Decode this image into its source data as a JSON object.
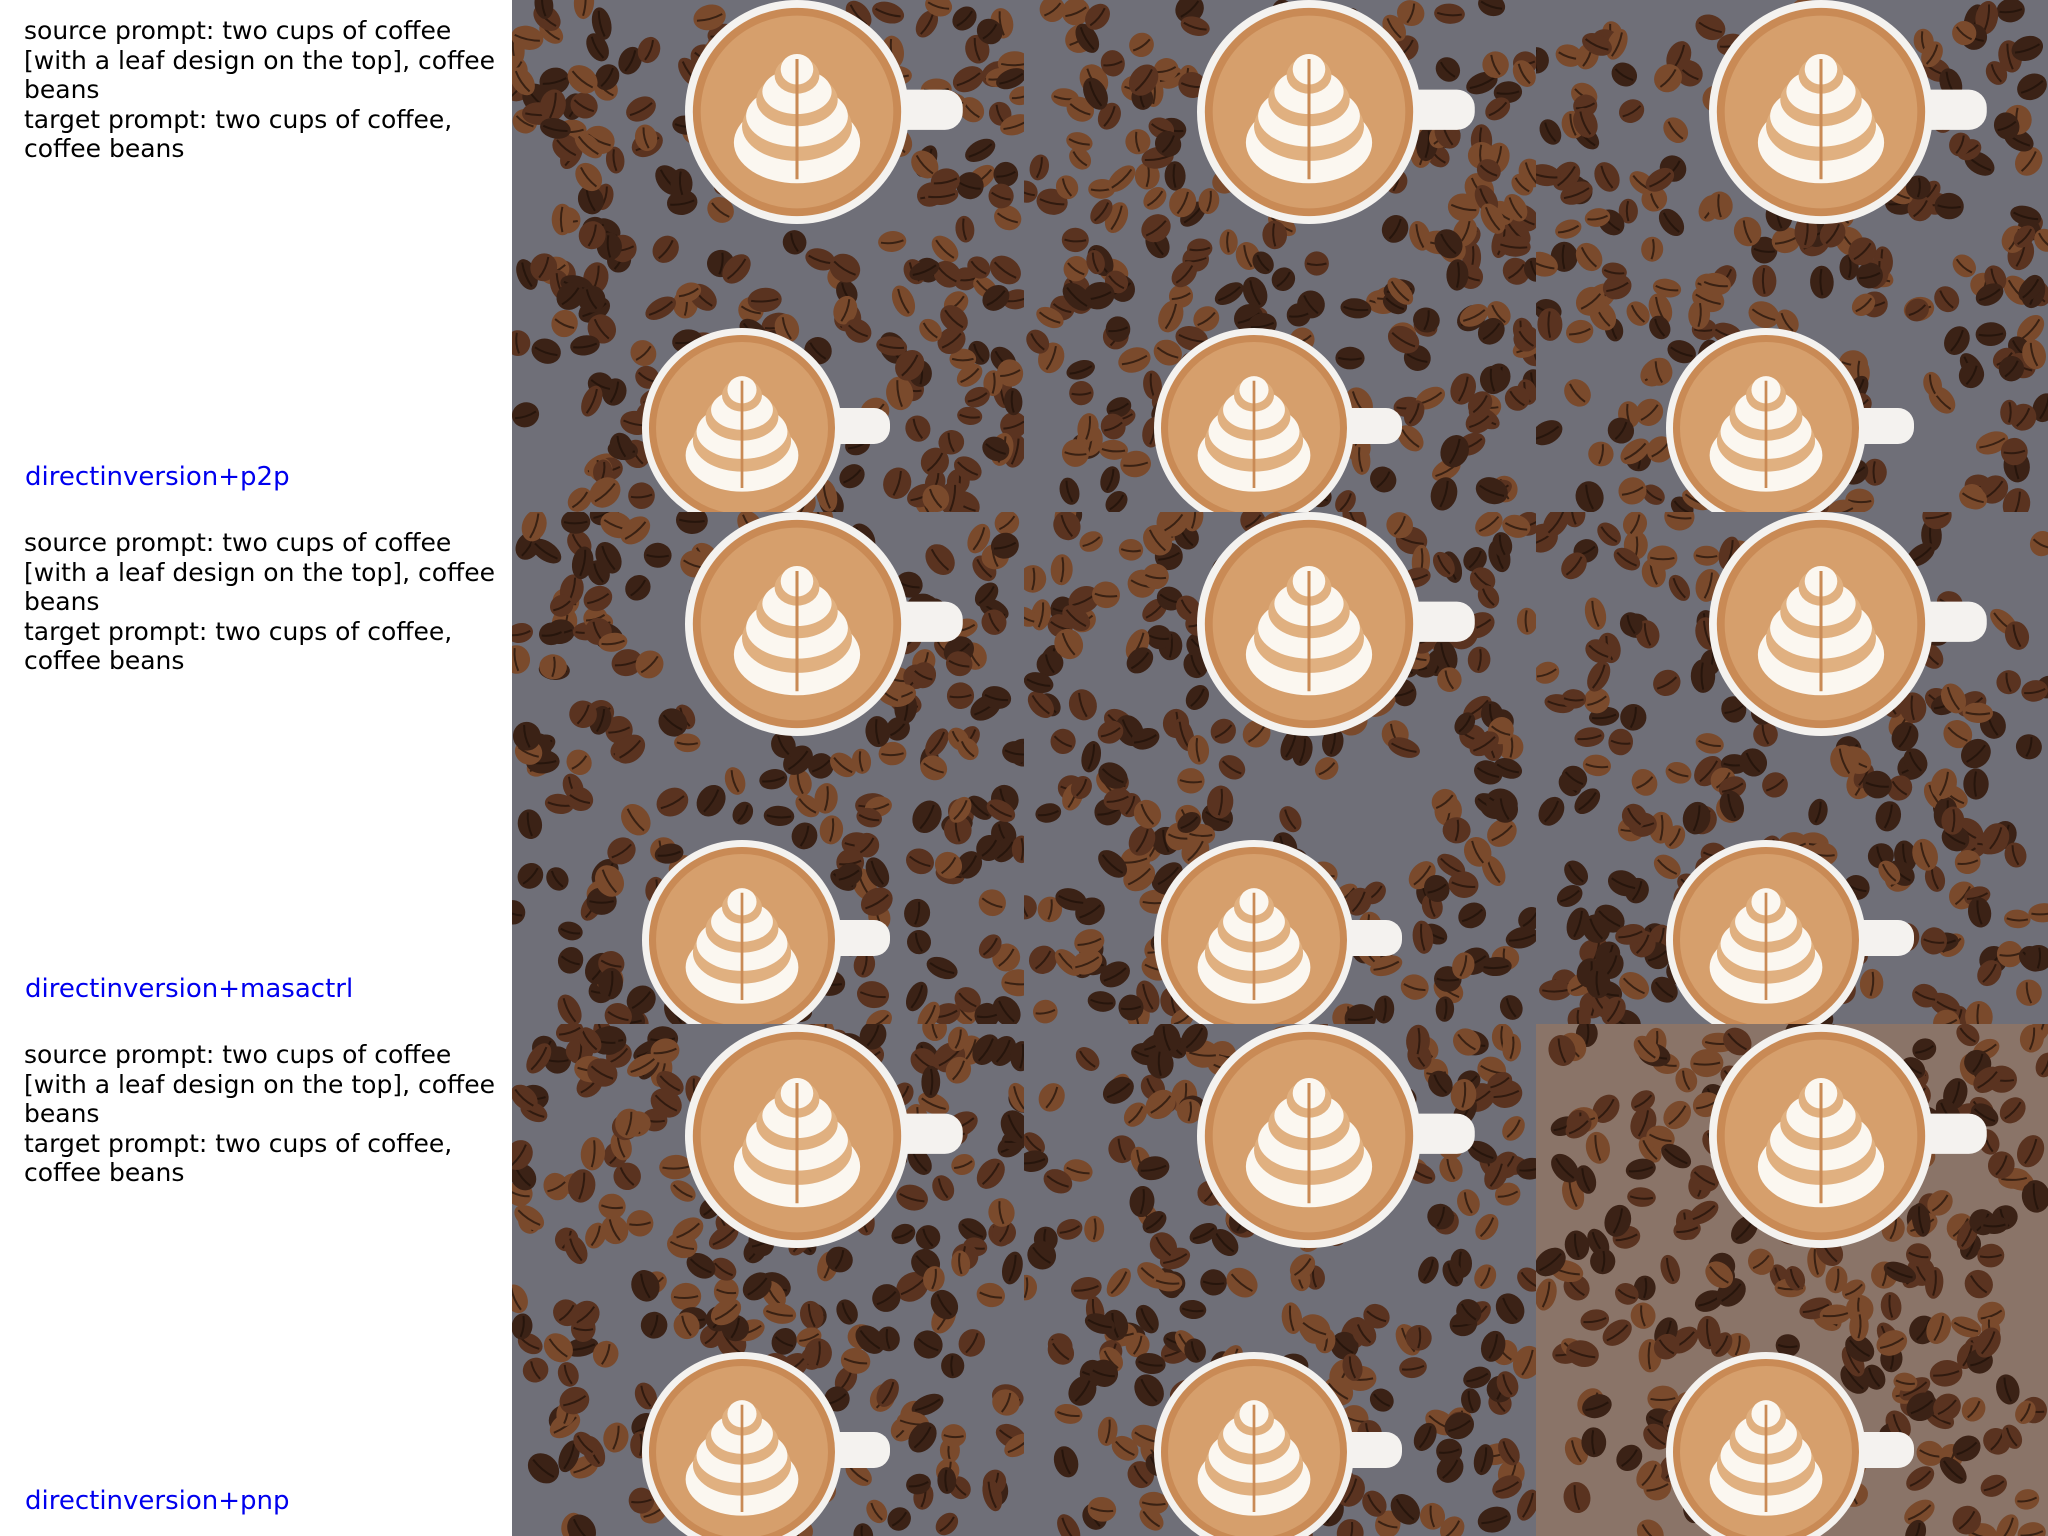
{
  "colors": {
    "method_label": "#0000ee",
    "prompt_text": "#000000",
    "table_gray": "#6f6f78",
    "table_warm": "#8a7468",
    "bean_dark": "#3b2216",
    "bean_mid": "#5a3320",
    "bean_light": "#7a4a2c",
    "cup_rim": "#f4f2ef",
    "crema": "#c98a55",
    "crema_light": "#e0b080",
    "foam": "#fbf7f0"
  },
  "rows": [
    {
      "source_prompt": "source prompt: two cups of coffee [with a leaf design on the top], coffee beans",
      "target_prompt": "target prompt: two cups of coffee, coffee beans",
      "method": "directinversion+p2p",
      "images": [
        {
          "icon": "coffee-cups-latte-art",
          "tone": "gray"
        },
        {
          "icon": "coffee-cups-latte-art",
          "tone": "gray"
        },
        {
          "icon": "coffee-cups-latte-art",
          "tone": "gray"
        }
      ]
    },
    {
      "source_prompt": "source prompt: two cups of coffee [with a leaf design on the top], coffee beans",
      "target_prompt": "target prompt: two cups of coffee, coffee beans",
      "method": "directinversion+masactrl",
      "images": [
        {
          "icon": "coffee-cups-latte-art",
          "tone": "gray"
        },
        {
          "icon": "coffee-cups-latte-art",
          "tone": "gray"
        },
        {
          "icon": "coffee-cups-latte-art",
          "tone": "gray"
        }
      ]
    },
    {
      "source_prompt": "source prompt: two cups of coffee [with a leaf design on the top], coffee beans",
      "target_prompt": "target prompt: two cups of coffee, coffee beans",
      "method": "directinversion+pnp",
      "images": [
        {
          "icon": "coffee-cups-latte-art",
          "tone": "gray"
        },
        {
          "icon": "coffee-cups-latte-art",
          "tone": "gray"
        },
        {
          "icon": "coffee-cups-latte-art",
          "tone": "warm"
        }
      ]
    }
  ]
}
